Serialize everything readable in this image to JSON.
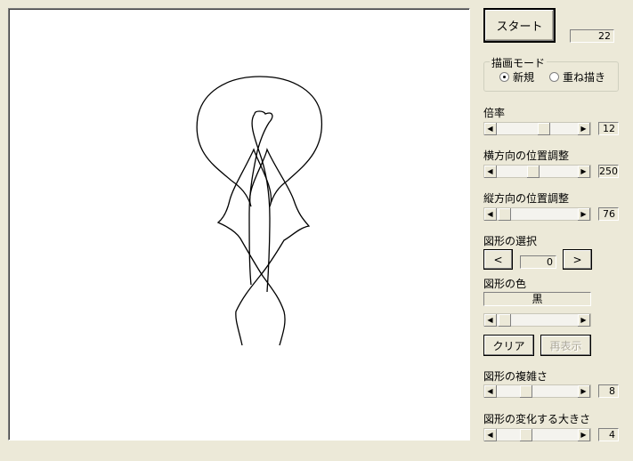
{
  "controls": {
    "start_label": "スタート",
    "counter_value": "22",
    "mode_group_title": "描画モード",
    "mode_options": [
      "新規",
      "重ね描き"
    ],
    "mode_selected": "新規",
    "scale_label": "倍率",
    "scale_value": "12",
    "hpos_label": "横方向の位置調整",
    "hpos_value": "250",
    "vpos_label": "縦方向の位置調整",
    "vpos_value": "76",
    "shape_select_label": "図形の選択",
    "shape_prev_label": "<",
    "shape_index_value": "0",
    "shape_next_label": ">",
    "color_label": "図形の色",
    "color_value": "黒",
    "clear_label": "クリア",
    "redraw_label": "再表示",
    "complexity_label": "図形の複雑さ",
    "complexity_value": "8",
    "variation_label": "図形の変化する大きさ",
    "variation_value": "4"
  },
  "colors": {
    "window_bg": "#ece9d8",
    "canvas_bg": "#ffffff",
    "stroke": "#000000"
  }
}
